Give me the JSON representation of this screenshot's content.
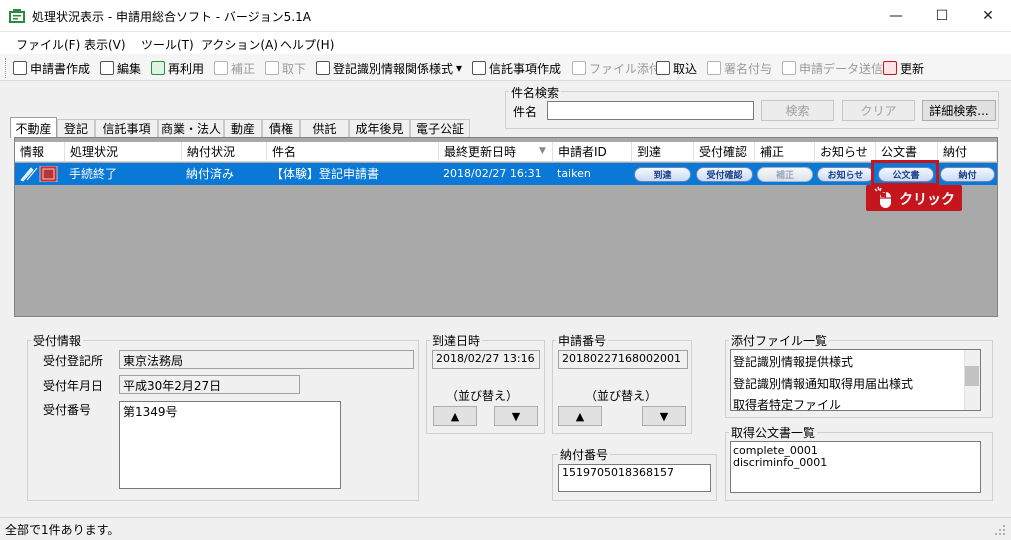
{
  "window": {
    "title": "処理状況表示 - 申請用総合ソフト - バージョン5.1A",
    "minimize_icon": "—",
    "maximize_icon": "☐",
    "close_icon": "✕"
  },
  "menu": [
    "ファイル(F)",
    "表示(V)",
    "ツール(T)",
    "アクション(A)",
    "ヘルプ(H)"
  ],
  "toolbar": {
    "create_application": "申請書作成",
    "edit": "編集",
    "reuse": "再利用",
    "correct": "補正",
    "withdraw": "取下",
    "registration_form": "登記識別情報関係様式",
    "dropdown_arrow": "▾",
    "trust_create": "信託事項作成",
    "attach_file": "ファイル添付",
    "import": "取込",
    "sign": "署名付与",
    "send_data": "申請データ送信",
    "refresh": "更新"
  },
  "search": {
    "group_label": "件名検索",
    "field_label": "件名",
    "value": "",
    "search_button": "検索",
    "clear_button": "クリア",
    "detail_button": "詳細検索..."
  },
  "tabs": [
    "不動産",
    "登記",
    "信託事項",
    "商業・法人",
    "動産",
    "債権",
    "供託",
    "成年後見",
    "電子公証"
  ],
  "grid": {
    "columns": [
      "情報",
      "処理状況",
      "納付状況",
      "件名",
      "最終更新日時",
      "申請者ID",
      "到達",
      "受付確認",
      "補正",
      "お知らせ",
      "公文書",
      "納付"
    ],
    "sort_indicator": "▼",
    "row": {
      "status": "手続終了",
      "payment_status": "納付済み",
      "subject": "【体験】登記申請書",
      "updated": "2018/02/27 16:31",
      "applicant_id": "taiken",
      "arrival_btn": "到達",
      "receipt_btn": "受付確認",
      "correction_btn": "補正",
      "notice_btn": "お知らせ",
      "document_btn": "公文書",
      "payment_btn": "納付"
    }
  },
  "callout": {
    "label": "クリック",
    "color": "#c4161c"
  },
  "reception": {
    "group_label": "受付情報",
    "office_label": "受付登記所",
    "office_value": "東京法務局",
    "date_label": "受付年月日",
    "date_value": "平成30年2月27日",
    "number_label": "受付番号",
    "number_value": "第1349号"
  },
  "arrival": {
    "group_label": "到達日時",
    "value": "2018/02/27 13:16",
    "sort_label": "（並び替え）",
    "up": "▲",
    "down": "▼"
  },
  "application_no": {
    "group_label": "申請番号",
    "value": "20180227168002001",
    "sort_label": "（並び替え）",
    "up": "▲",
    "down": "▼"
  },
  "payment_no": {
    "group_label": "納付番号",
    "value": "1519705018368157"
  },
  "attachments": {
    "group_label": "添付ファイル一覧",
    "items": [
      "登記識別情報提供様式",
      "登記識別情報通知取得用届出様式",
      "取得者特定ファイル"
    ]
  },
  "official_docs": {
    "group_label": "取得公文書一覧",
    "items": [
      "complete_0001",
      "discriminfo_0001"
    ]
  },
  "status": {
    "text": "全部で1件あります。"
  }
}
